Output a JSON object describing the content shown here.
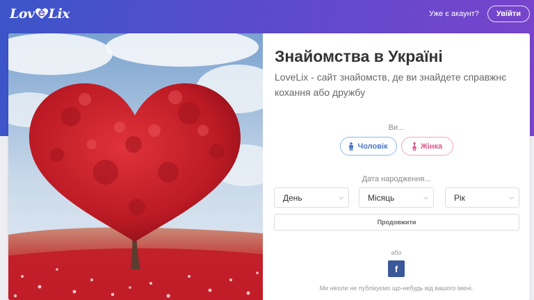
{
  "header": {
    "logo_left": "Lov",
    "logo_right": "Lix",
    "already_text": "Уже є акаунт?",
    "login_label": "Увійти"
  },
  "main": {
    "title": "Знайомства в Україні",
    "subtitle": "LoveLix - сайт знайомств, де ви знайдете справжнє кохання або дружбу",
    "you_label": "Ви...",
    "gender_male": "Чоловік",
    "gender_female": "Жінка",
    "dob_label": "Дата народження...",
    "day_select": "День",
    "month_select": "Місяць",
    "year_select": "Рік",
    "continue_label": "Продовжити",
    "or_label": "або",
    "facebook_letter": "f",
    "privacy_note": "Ми ніколи не публікуємо що-небудь від вашого імені."
  },
  "colors": {
    "header_gradient_start": "#3b55c9",
    "header_gradient_end": "#7a44cc",
    "male_accent": "#4a78c8",
    "female_accent": "#e0558a",
    "facebook": "#3b5998"
  },
  "icons": {
    "logo": "heart-e-icon",
    "male": "male-person-icon",
    "female": "female-person-icon",
    "social": "facebook-icon"
  }
}
